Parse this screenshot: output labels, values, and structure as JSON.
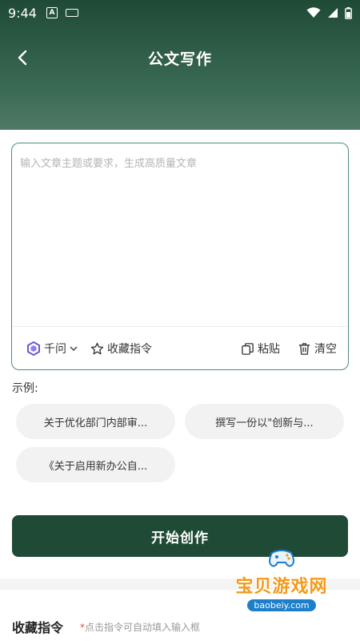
{
  "status_bar": {
    "time": "9:44",
    "notification_icon": "a-square-icon",
    "keyboard_icon": "keyboard-icon",
    "wifi_icon": "wifi-icon",
    "signal_icon": "signal-icon",
    "battery_icon": "battery-icon"
  },
  "nav": {
    "back_icon": "chevron-left-icon",
    "title": "公文写作"
  },
  "editor": {
    "placeholder": "输入文章主题或要求，生成高质量文章",
    "value": "",
    "model_label": "千问",
    "favorite_label": "收藏指令",
    "paste_label": "粘贴",
    "clear_label": "清空"
  },
  "examples": {
    "title": "示例:",
    "items": [
      "关于优化部门内部审...",
      "撰写一份以\"创新与...",
      "《关于启用新办公自..."
    ]
  },
  "actions": {
    "start_label": "开始创作"
  },
  "favorites": {
    "title": "收藏指令",
    "hint_star": "*",
    "hint": "点击指令可自动填入输入框"
  },
  "watermark": {
    "title": "宝贝游戏网",
    "domain": "baobeiy.com"
  },
  "colors": {
    "primary": "#1f4a36",
    "header_gradient_end": "#4f7a66",
    "accent_border": "#4e8f72",
    "chip_bg": "#f1f2f1",
    "required_red": "#e04848"
  }
}
